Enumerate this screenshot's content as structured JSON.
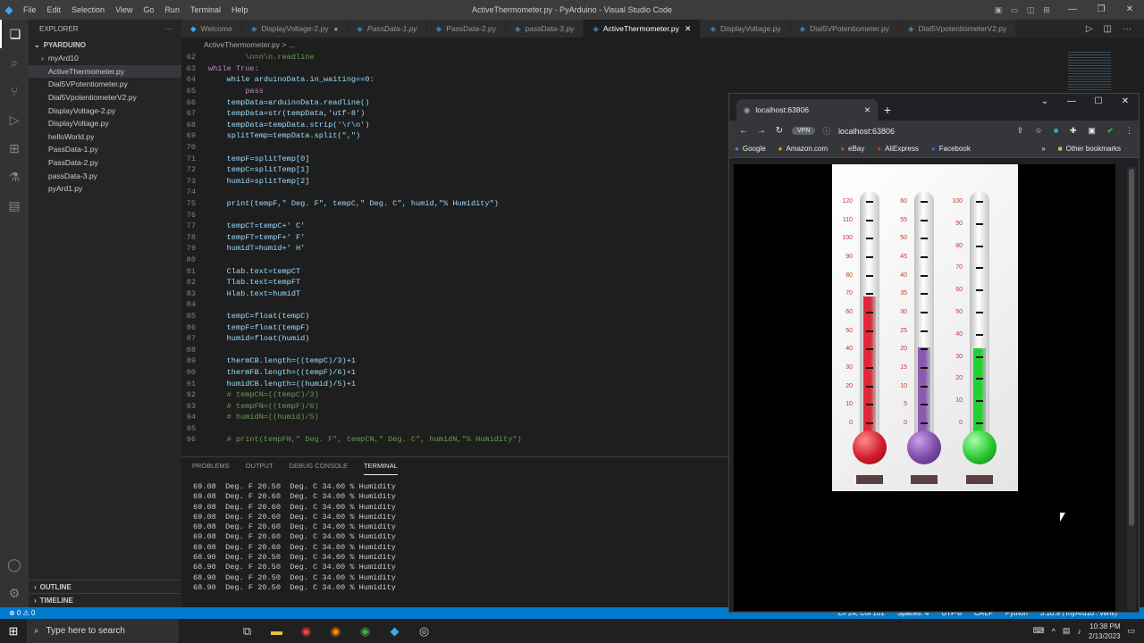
{
  "vscode": {
    "window_title": "ActiveThermometer.py - PyArduino - Visual Studio Code",
    "menu": [
      "File",
      "Edit",
      "Selection",
      "View",
      "Go",
      "Run",
      "Terminal",
      "Help"
    ],
    "explorer_label": "EXPLORER",
    "folder": "PYARDUINO",
    "files": [
      "myArd10",
      "ActiveThermometer.py",
      "Dial5VPotentiometer.py",
      "Dial5VpotentiometerV2.py",
      "DisplayVoltage-2.py",
      "DisplayVoltage.py",
      "helloWorld.py",
      "PassData-1.py",
      "PassData-2.py",
      "passData-3.py",
      "pyArd1.py"
    ],
    "outline": "OUTLINE",
    "timeline": "TIMELINE",
    "tabs": [
      "Welcome",
      "DisplayVoltage-2.py",
      "PassData-1.py",
      "PassData-2.py",
      "passData-3.py",
      "ActiveThermometer.py",
      "DisplayVoltage.py",
      "Dial5VPotentiometer.py",
      "Dial5VpotentiometerV2.py"
    ],
    "breadcrumb": "ActiveThermometer.py > ...",
    "code": [
      {
        "n": "62",
        "t": "        \\n=n\\n.readline",
        "k": "cm"
      },
      {
        "n": "63",
        "t": "while True:",
        "k": "kw"
      },
      {
        "n": "64",
        "t": "    while arduinoData.in_waiting==0:",
        "k": ""
      },
      {
        "n": "65",
        "t": "        pass",
        "k": "kw"
      },
      {
        "n": "66",
        "t": "    tempData=arduinoData.readline()",
        "k": ""
      },
      {
        "n": "67",
        "t": "    tempData=str(tempData,'utf-8')",
        "k": ""
      },
      {
        "n": "68",
        "t": "    tempData=tempData.strip('\\r\\n')",
        "k": ""
      },
      {
        "n": "69",
        "t": "    splitTemp=tempData.split(\",\")",
        "k": ""
      },
      {
        "n": "70",
        "t": "",
        "k": ""
      },
      {
        "n": "71",
        "t": "    tempF=splitTemp[0]",
        "k": ""
      },
      {
        "n": "72",
        "t": "    tempC=splitTemp[1]",
        "k": ""
      },
      {
        "n": "73",
        "t": "    humid=splitTemp[2]",
        "k": ""
      },
      {
        "n": "74",
        "t": "",
        "k": ""
      },
      {
        "n": "75",
        "t": "    print(tempF,\" Deg. F\", tempC,\" Deg. C\", humid,\"% Humidity\")",
        "k": ""
      },
      {
        "n": "76",
        "t": "",
        "k": ""
      },
      {
        "n": "77",
        "t": "    tempCT=tempC+' C'",
        "k": ""
      },
      {
        "n": "78",
        "t": "    tempFT=tempF+' F'",
        "k": ""
      },
      {
        "n": "79",
        "t": "    humidT=humid+' H'",
        "k": ""
      },
      {
        "n": "80",
        "t": "",
        "k": ""
      },
      {
        "n": "81",
        "t": "    Clab.text=tempCT",
        "k": ""
      },
      {
        "n": "82",
        "t": "    Tlab.text=tempFT",
        "k": ""
      },
      {
        "n": "83",
        "t": "    Hlab.text=humidT",
        "k": ""
      },
      {
        "n": "84",
        "t": "",
        "k": ""
      },
      {
        "n": "85",
        "t": "    tempC=float(tempC)",
        "k": ""
      },
      {
        "n": "86",
        "t": "    tempF=float(tempF)",
        "k": ""
      },
      {
        "n": "87",
        "t": "    humid=float(humid)",
        "k": ""
      },
      {
        "n": "88",
        "t": "",
        "k": ""
      },
      {
        "n": "89",
        "t": "    thermCB.length=((tempC)/3)+1",
        "k": ""
      },
      {
        "n": "90",
        "t": "    thermFB.length=((tempF)/6)+1",
        "k": ""
      },
      {
        "n": "91",
        "t": "    humidCB.length=((humid)/5)+1",
        "k": ""
      },
      {
        "n": "92",
        "t": "    # tempCN=((tempC)/3)",
        "k": "cm"
      },
      {
        "n": "93",
        "t": "    # tempFN=((tempF)/6)",
        "k": "cm"
      },
      {
        "n": "94",
        "t": "    # humidN=((humid)/5)",
        "k": "cm"
      },
      {
        "n": "95",
        "t": "",
        "k": ""
      },
      {
        "n": "96",
        "t": "    # print(tempFN,\" Deg. F\", tempCN,\" Deg. C\", humidN,\"% Humidity\")",
        "k": "cm"
      }
    ],
    "panel_tabs": [
      "PROBLEMS",
      "OUTPUT",
      "DEBUG CONSOLE",
      "TERMINAL"
    ],
    "terminal": [
      "69.08  Deg. F 20.50  Deg. C 34.00 % Humidity",
      "69.08  Deg. F 20.60  Deg. C 34.00 % Humidity",
      "69.08  Deg. F 20.60  Deg. C 34.00 % Humidity",
      "69.08  Deg. F 20.60  Deg. C 34.00 % Humidity",
      "69.08  Deg. F 20.60  Deg. C 34.00 % Humidity",
      "69.08  Deg. F 20.60  Deg. C 34.00 % Humidity",
      "69.08  Deg. F 20.60  Deg. C 34.00 % Humidity",
      "68.90  Deg. F 20.50  Deg. C 34.00 % Humidity",
      "68.90  Deg. F 20.50  Deg. C 34.00 % Humidity",
      "68.90  Deg. F 20.50  Deg. C 34.00 % Humidity",
      "68.90  Deg. F 20.50  Deg. C 34.00 % Humidity"
    ],
    "status_left": "⊗ 0  ⚠ 0",
    "status_right": [
      "Ln 24, Col 101",
      "Spaces: 4",
      "UTF-8",
      "CRLF",
      "Python",
      "3.10.9 ('myArd10': venv)"
    ]
  },
  "browser": {
    "tab_title": "localhost:63806",
    "url": "localhost:63806",
    "vpn": "VPN",
    "bookmarks": [
      "Google",
      "Amazon.com",
      "eBay",
      "AliExpress",
      "Facebook"
    ],
    "other_bookmarks": "Other bookmarks",
    "thermometers": {
      "fahrenheit": {
        "scale": [
          "120",
          "110",
          "100",
          "90",
          "80",
          "70",
          "60",
          "50",
          "40",
          "30",
          "20",
          "10",
          "0"
        ],
        "value": 68.9,
        "color": "#e0283a"
      },
      "celsius": {
        "scale": [
          "60",
          "55",
          "50",
          "45",
          "40",
          "35",
          "30",
          "25",
          "20",
          "15",
          "10",
          "5",
          "0"
        ],
        "value": 20.5,
        "color": "#8a5ab0"
      },
      "humidity": {
        "scale": [
          "100",
          "90",
          "80",
          "70",
          "60",
          "50",
          "40",
          "30",
          "20",
          "10",
          "0"
        ],
        "value": 34.0,
        "color": "#22d030"
      }
    }
  },
  "taskbar": {
    "search_placeholder": "Type here to search",
    "time": "10:38 PM",
    "date": "2/13/2023"
  }
}
